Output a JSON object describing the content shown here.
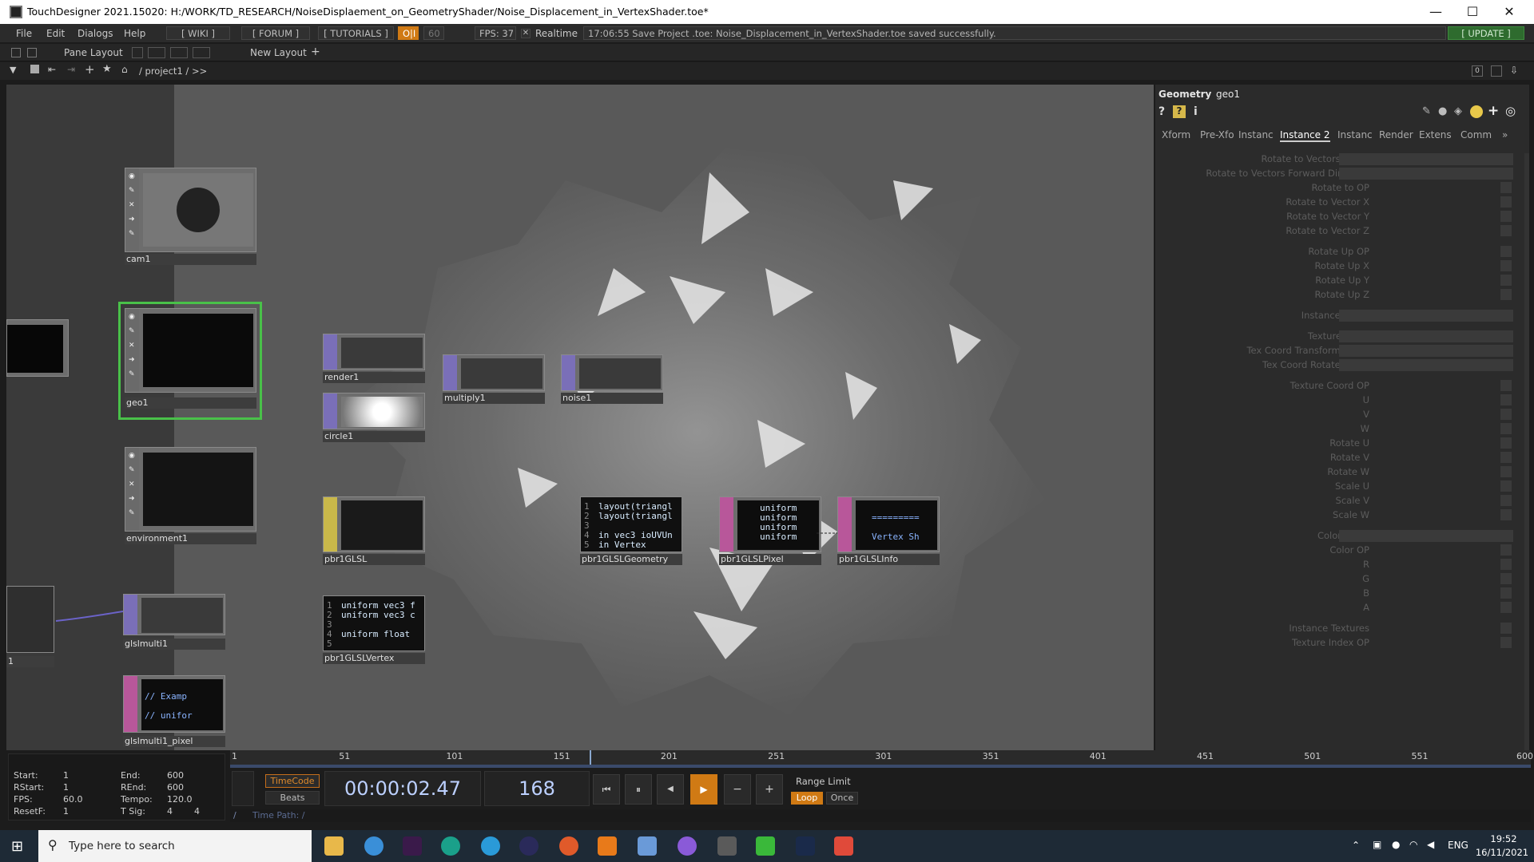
{
  "window": {
    "title": "TouchDesigner 2021.15020: H:/WORK/TD_RESEARCH/NoiseDisplaement_on_GeometryShader/Noise_Displacement_in_VertexShader.toe*",
    "minimize": "—",
    "maximize": "☐",
    "close": "✕"
  },
  "menubar": {
    "items": [
      "File",
      "Edit",
      "Dialogs",
      "Help"
    ],
    "wiki": "[ WIKI ]",
    "forum": "[ FORUM ]",
    "tutorials": "[ TUTORIALS ]",
    "oi": "O|I",
    "fps_target": "60",
    "fps": "FPS: 37",
    "realtime": "Realtime",
    "status": "17:06:55 Save Project .toe: Noise_Displacement_in_VertexShader.toe saved successfully.",
    "update": "[ UPDATE ]"
  },
  "panebar": {
    "pane_layout": "Pane Layout",
    "new_layout": "New Layout",
    "plus": "+"
  },
  "pathbar": {
    "path": "/ project1 / >>"
  },
  "nodes": {
    "cam1": "cam1",
    "geo1": "geo1",
    "environment1": "environment1",
    "glslmulti1": "glslmulti1",
    "glslmulti1_pixel": "glslmulti1_pixel",
    "render1": "render1",
    "circle1": "circle1",
    "multiply1": "multiply1",
    "noise1": "noise1",
    "pbr1GLSL": "pbr1GLSL",
    "pbr1GLSLVertex": "pbr1GLSLVertex",
    "pbr1GLSLGeometry": "pbr1GLSLGeometry",
    "pbr1GLSLPixel": "pbr1GLSLPixel",
    "pbr1GLSLInfo": "pbr1GLSLInfo",
    "left_partial": "1",
    "code_geometry": [
      "layout(triangl",
      "layout(triangl",
      "",
      "in vec3 ioUVUn",
      "in Vertex"
    ],
    "code_pixel": [
      "uniform",
      "uniform",
      "uniform",
      "uniform",
      "uniform"
    ],
    "code_info": [
      "",
      "=========",
      "",
      "Vertex Sh",
      ""
    ],
    "code_vertex": [
      "uniform vec3 f",
      "uniform vec3 c",
      "",
      "uniform float",
      ""
    ],
    "code_glslpixel": [
      "",
      "// Examp",
      "",
      "// unifor",
      ""
    ]
  },
  "params": {
    "type": "Geometry",
    "name": "geo1",
    "tabs": [
      "Xform",
      "Pre-Xfo",
      "Instanc",
      "Instance 2",
      "Instanc",
      "Render",
      "Extens",
      "Comm"
    ],
    "active_tab": "Instance 2",
    "labels": [
      "Rotate to Vectors Order",
      "Rotate to Vectors Forward Direction",
      "Rotate to OP",
      "Rotate to Vector X",
      "Rotate to Vector Y",
      "Rotate to Vector Z",
      "Rotate Up OP",
      "Rotate Up X",
      "Rotate Up Y",
      "Rotate Up Z",
      "Instance Order",
      "Texture Mode",
      "Tex Coord Transform Order",
      "Tex Coord Rotate Order",
      "Texture Coord OP",
      "U",
      "V",
      "W",
      "Rotate U",
      "Rotate V",
      "Rotate W",
      "Scale U",
      "Scale V",
      "Scale W",
      "Color Mode",
      "Color OP",
      "R",
      "G",
      "B",
      "A",
      "Instance Textures",
      "Texture Index OP"
    ]
  },
  "timeline": {
    "ticks": [
      "1",
      "51",
      "101",
      "151",
      "201",
      "251",
      "301",
      "351",
      "401",
      "451",
      "501",
      "551",
      "600"
    ],
    "playhead_frame": 168,
    "start_label": "Start:",
    "start": "1",
    "end_label": "End:",
    "end": "600",
    "rstart_label": "RStart:",
    "rstart": "1",
    "rend_label": "REnd:",
    "rend": "600",
    "fps_label": "FPS:",
    "fps": "60.0",
    "tempo_label": "Tempo:",
    "tempo": "120.0",
    "resetf_label": "ResetF:",
    "resetf": "1",
    "tsig_label": "T Sig:",
    "tsig1": "4",
    "tsig2": "4",
    "timecode_btn": "TimeCode",
    "beats_btn": "Beats",
    "timecode": "00:00:02.47",
    "frame": "168",
    "range_limit": "Range Limit",
    "loop": "Loop",
    "once": "Once",
    "time_path": "Time Path: /"
  },
  "taskbar": {
    "search_placeholder": "Type here to search",
    "lang": "ENG",
    "time": "19:52",
    "date": "16/11/2021"
  }
}
